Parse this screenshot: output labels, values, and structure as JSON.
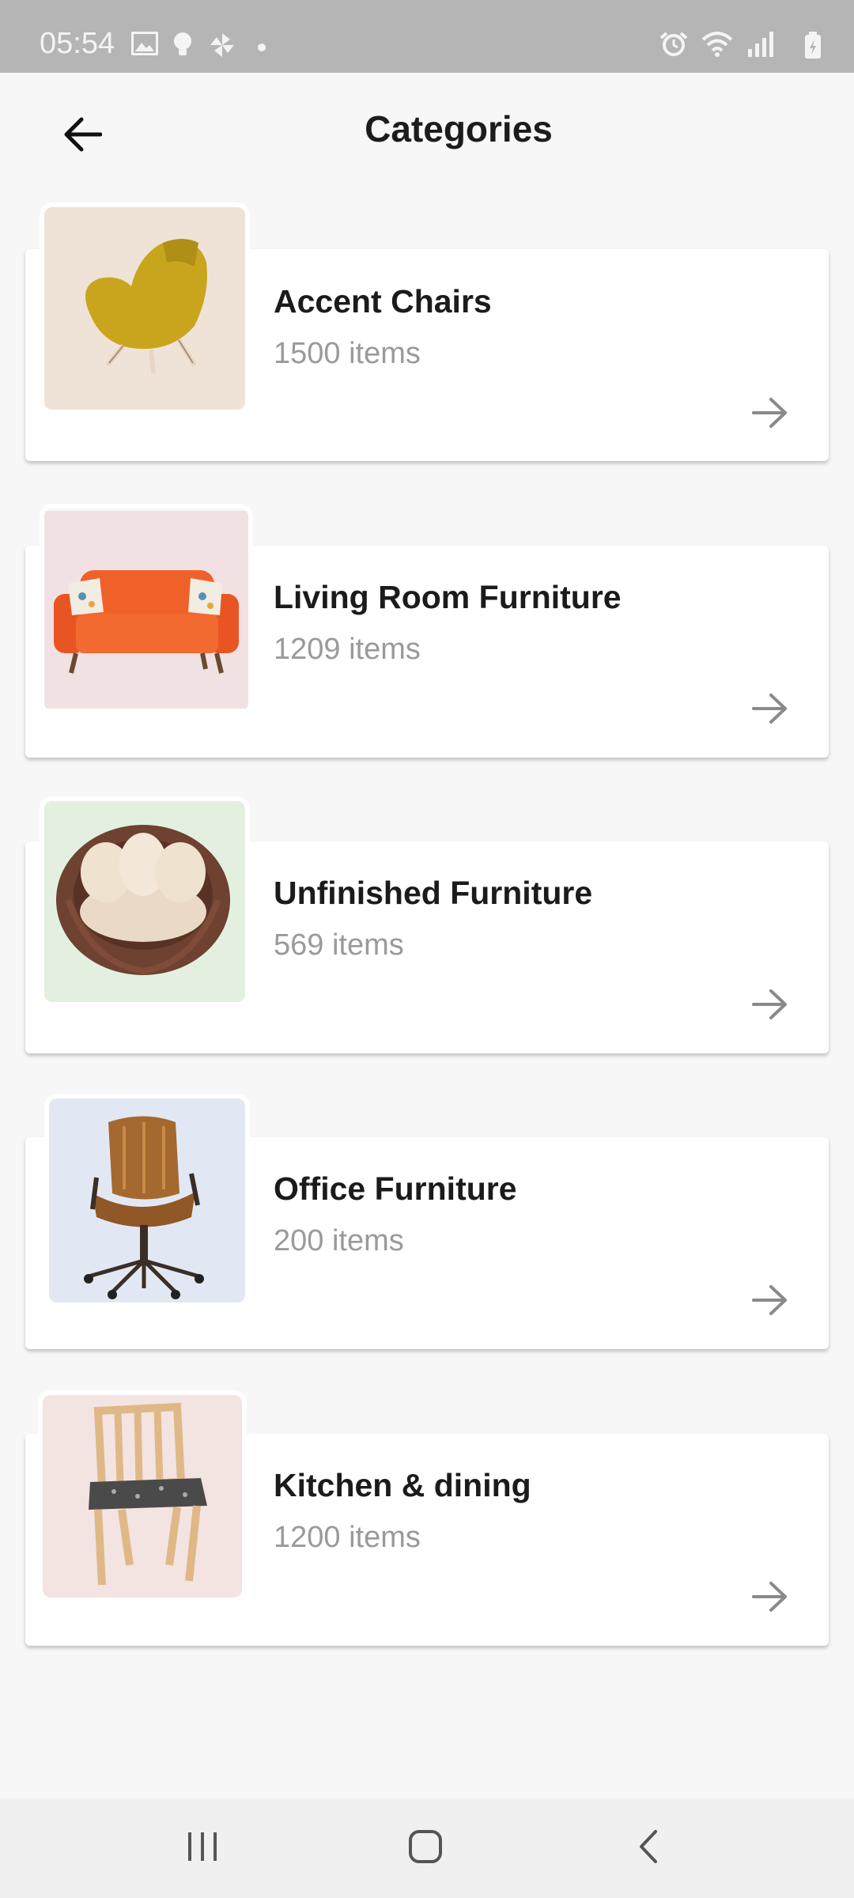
{
  "status_bar": {
    "time": "05:54",
    "left_icons": [
      "image-icon",
      "bulb-icon",
      "pinwheel-icon",
      "dot-icon"
    ],
    "right_icons": [
      "alarm-icon",
      "wifi-icon",
      "signal-icon",
      "battery-icon"
    ]
  },
  "header": {
    "title": "Categories",
    "back_icon": "back-arrow-icon"
  },
  "categories": [
    {
      "name": "Accent Chairs",
      "count": "1500 items",
      "thumb_bg": "#efe3d8",
      "icon": "accent-chair-image"
    },
    {
      "name": "Living Room Furniture",
      "count": "1209 items",
      "thumb_bg": "#f2e1e3",
      "icon": "sofa-image"
    },
    {
      "name": "Unfinished Furniture",
      "count": "569 items",
      "thumb_bg": "#e3f0df",
      "icon": "round-chair-image"
    },
    {
      "name": "Office Furniture",
      "count": "200 items",
      "thumb_bg": "#e2e8f3",
      "icon": "office-chair-image"
    },
    {
      "name": "Kitchen & dining",
      "count": "1200 items",
      "thumb_bg": "#f3e4e2",
      "icon": "dining-chair-image"
    }
  ],
  "nav_bar": {
    "buttons": [
      "recents-icon",
      "home-icon",
      "back-icon"
    ]
  },
  "colors": {
    "status_bar": "#b5b5b5",
    "background": "#f7f7f7",
    "card": "#ffffff",
    "title_text": "#1c1c1c",
    "count_text": "#9a9a9a",
    "arrow": "#8a8a8a"
  }
}
